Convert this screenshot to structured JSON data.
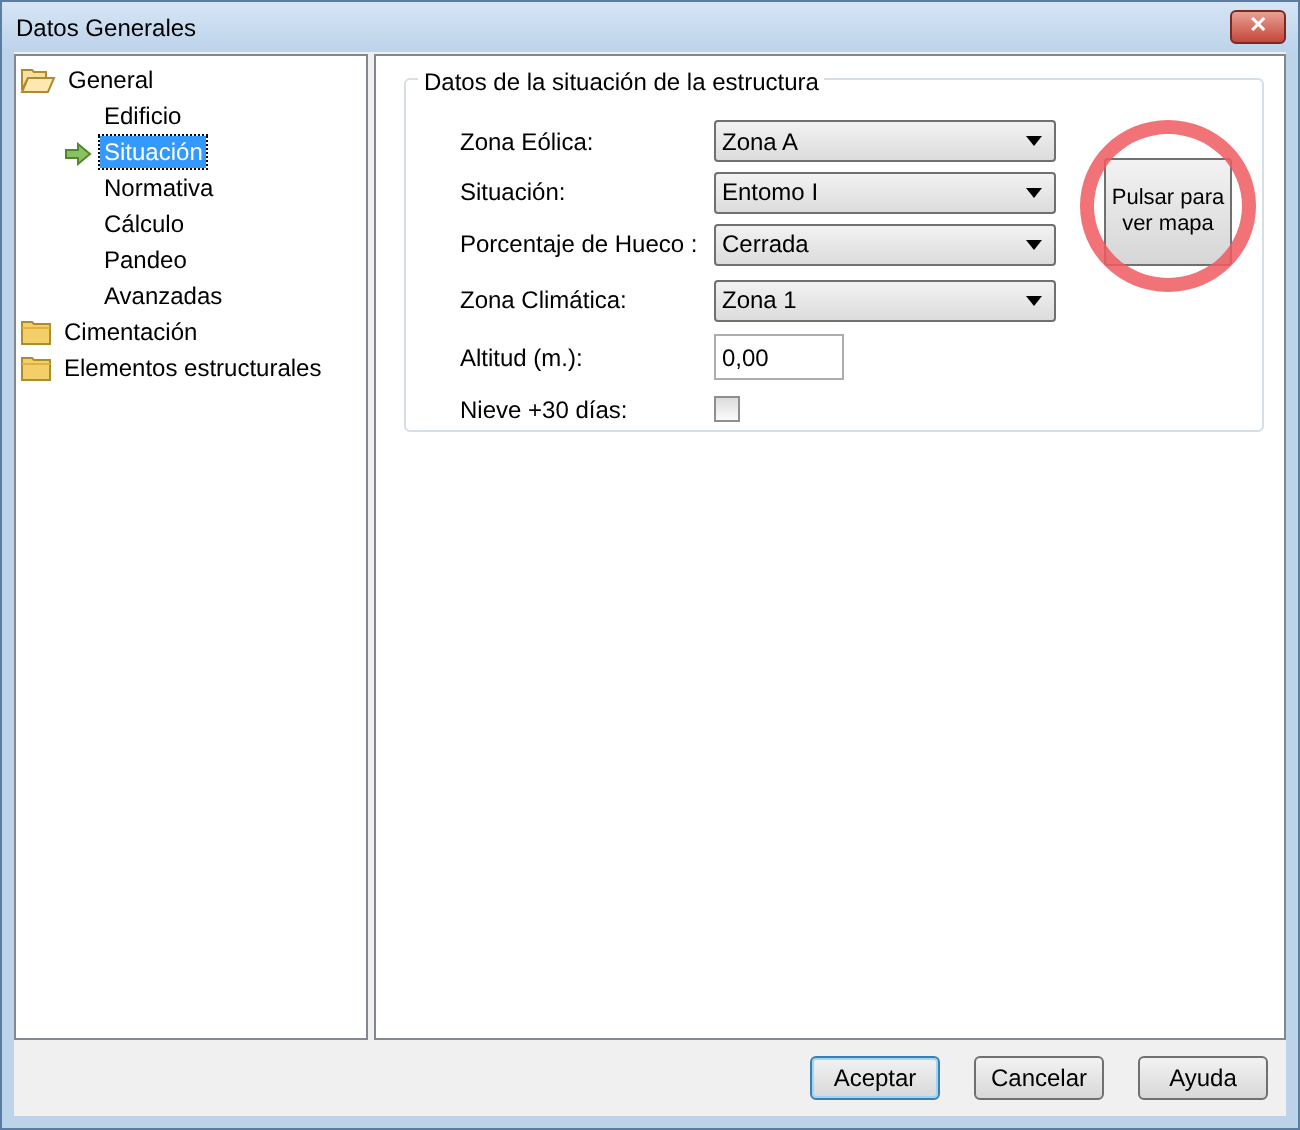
{
  "window": {
    "title": "Datos Generales",
    "close": "✕"
  },
  "tree": [
    {
      "label": "General",
      "expanded": true,
      "children": [
        {
          "label": "Edificio",
          "selected": false
        },
        {
          "label": "Situación",
          "selected": true
        },
        {
          "label": "Normativa",
          "selected": false
        },
        {
          "label": "Cálculo",
          "selected": false
        },
        {
          "label": "Pandeo",
          "selected": false
        },
        {
          "label": "Avanzadas",
          "selected": false
        }
      ]
    },
    {
      "label": "Cimentación",
      "expanded": false
    },
    {
      "label": "Elementos estructurales",
      "expanded": false
    }
  ],
  "group": {
    "title": "Datos de la situación de la estructura",
    "fields": [
      {
        "kind": "select",
        "label": "Zona Eólica:",
        "value": "Zona A"
      },
      {
        "kind": "select",
        "label": "Situación:",
        "value": "Entomo I"
      },
      {
        "kind": "select",
        "label": "Porcentaje de Hueco :",
        "value": "Cerrada"
      },
      {
        "kind": "select",
        "label": "Zona Climática:",
        "value": "Zona 1"
      },
      {
        "kind": "text",
        "label": "Altitud (m.):",
        "value": "0,00"
      },
      {
        "kind": "checkbox",
        "label": "Nieve +30 días:",
        "checked": false
      }
    ],
    "map_button": {
      "label": "Pulsar para ver mapa",
      "highlighted": true
    }
  },
  "buttons": [
    {
      "label": "Aceptar",
      "default": true
    },
    {
      "label": "Cancelar",
      "default": false
    },
    {
      "label": "Ayuda",
      "default": false
    }
  ]
}
